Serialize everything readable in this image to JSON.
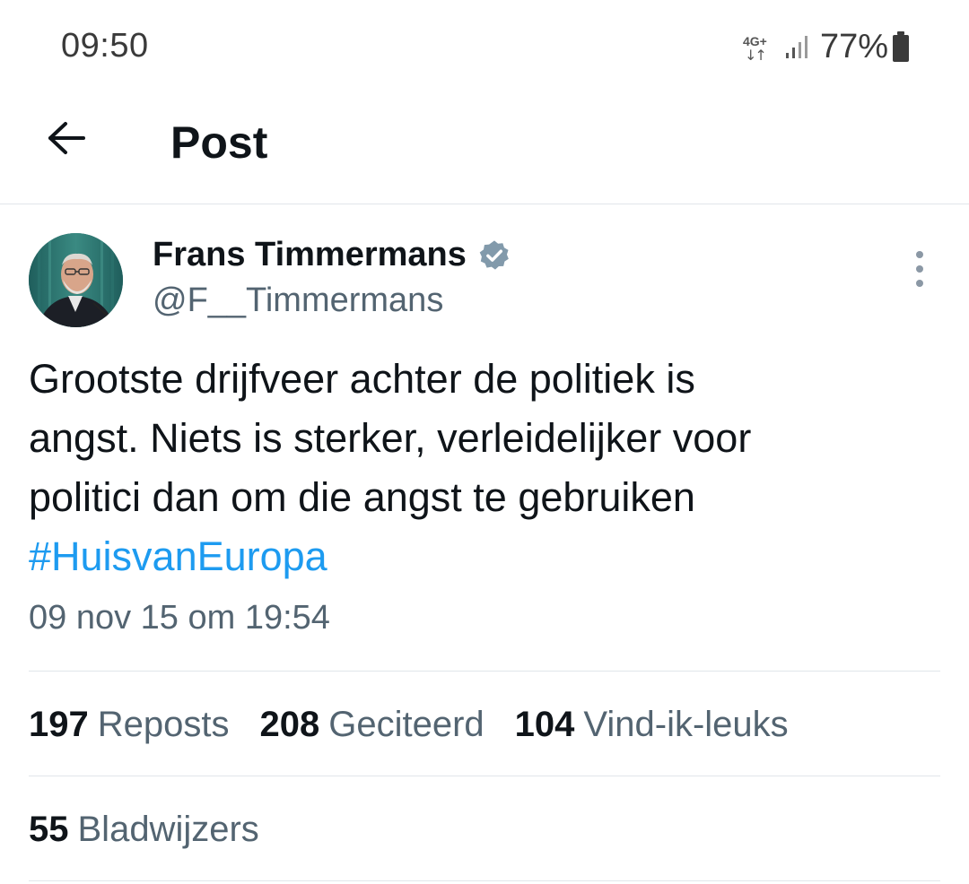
{
  "status_bar": {
    "time": "09:50",
    "network": "4G+",
    "network_arrows": "↓↑",
    "battery": "77%",
    "icons": [
      "network-4g-icon",
      "signal-icon",
      "battery-icon"
    ]
  },
  "header": {
    "title": "Post",
    "back_icon": "arrow-left-icon"
  },
  "post": {
    "author_name": "Frans Timmermans",
    "author_handle": "@F__Timmermans",
    "verified": true,
    "text_lines": [
      "Grootste drijfveer achter de politiek is",
      "angst. Niets is sterker, verleidelijker voor",
      "politici dan om die angst te gebruiken"
    ],
    "hashtag": "#HuisvanEuropa",
    "timestamp": "09 nov 15 om 19:54",
    "stats": {
      "reposts_count": "197",
      "reposts_label": "Reposts",
      "quotes_count": "208",
      "quotes_label": "Geciteerd",
      "likes_count": "104",
      "likes_label": "Vind-ik-leuks",
      "bookmarks_count": "55",
      "bookmarks_label": "Bladwijzers"
    }
  },
  "colors": {
    "text_primary": "#0f1419",
    "text_secondary": "#536471",
    "accent": "#1d9bf0",
    "verified_badge": "#829aab",
    "divider": "#e1e6ea"
  }
}
